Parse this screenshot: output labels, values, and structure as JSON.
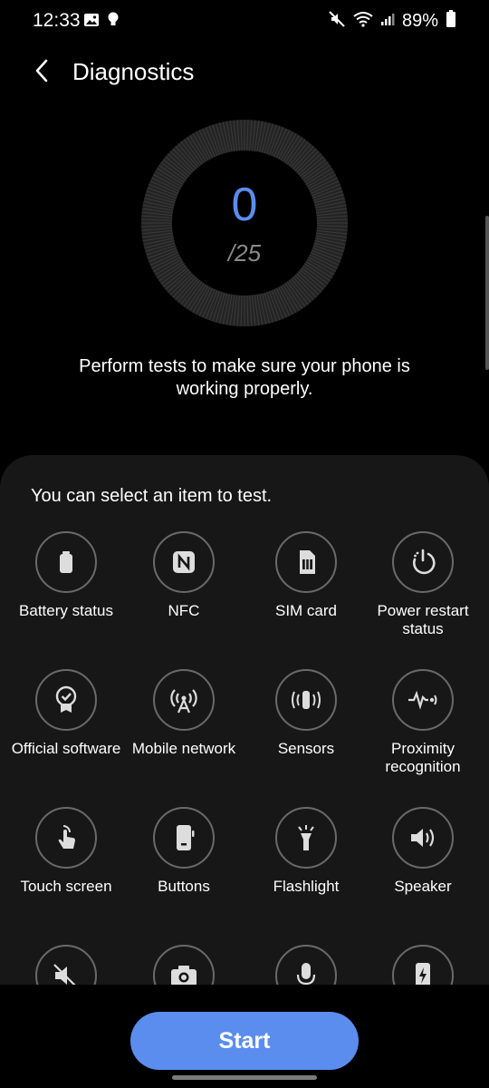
{
  "status_bar": {
    "time": "12:33",
    "battery": "89%"
  },
  "header": {
    "title": "Diagnostics"
  },
  "progress": {
    "count": "0",
    "total": "/25"
  },
  "intro": {
    "text": "Perform tests to make sure your phone is working properly."
  },
  "panel": {
    "hint": "You can select an item to test."
  },
  "tests": [
    {
      "label": "Battery status",
      "icon": "battery-icon"
    },
    {
      "label": "NFC",
      "icon": "nfc-icon"
    },
    {
      "label": "SIM card",
      "icon": "sim-card-icon"
    },
    {
      "label": "Power restart status",
      "icon": "power-restart-icon"
    },
    {
      "label": "Official software",
      "icon": "certificate-icon"
    },
    {
      "label": "Mobile network",
      "icon": "antenna-icon"
    },
    {
      "label": "Sensors",
      "icon": "vibration-icon"
    },
    {
      "label": "Proximity recognition",
      "icon": "proximity-icon"
    },
    {
      "label": "Touch screen",
      "icon": "touch-icon"
    },
    {
      "label": "Buttons",
      "icon": "phone-buttons-icon"
    },
    {
      "label": "Flashlight",
      "icon": "flashlight-icon"
    },
    {
      "label": "Speaker",
      "icon": "speaker-icon"
    },
    {
      "label": "",
      "icon": "vibration-mute-icon"
    },
    {
      "label": "",
      "icon": "camera-icon"
    },
    {
      "label": "",
      "icon": "microphone-icon"
    },
    {
      "label": "",
      "icon": "charging-icon"
    }
  ],
  "actions": {
    "start": "Start"
  },
  "colors": {
    "accent": "#5b8def",
    "panel": "#171717",
    "background": "#000000"
  }
}
